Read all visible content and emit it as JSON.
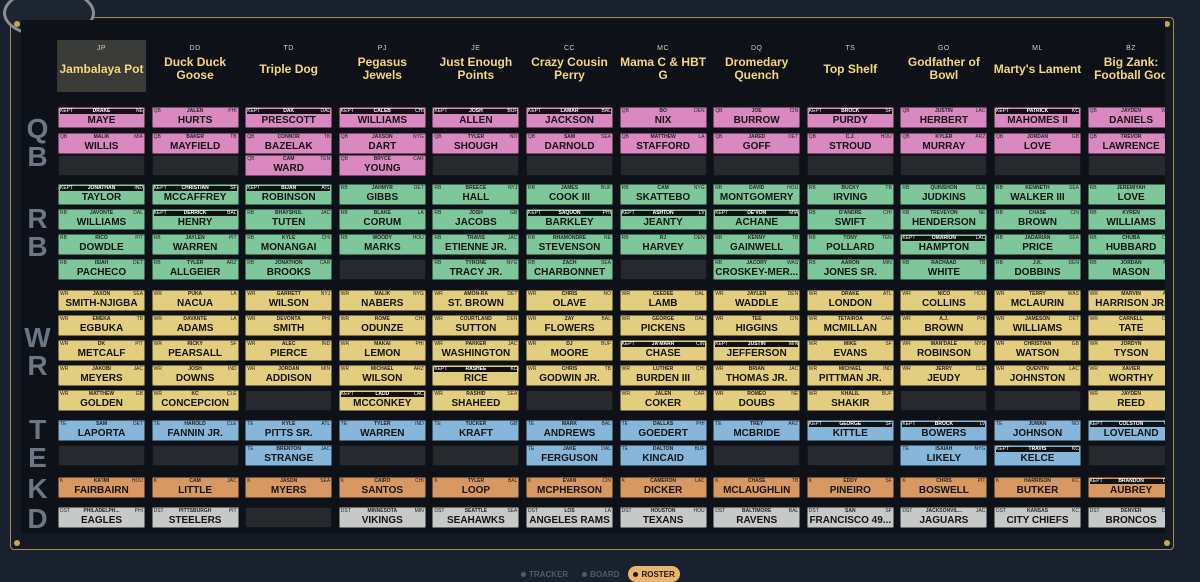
{
  "teams": [
    {
      "initials": "JP",
      "name": "Jambalaya Pot"
    },
    {
      "initials": "DD",
      "name": "Duck Duck Goose"
    },
    {
      "initials": "TD",
      "name": "Triple Dog"
    },
    {
      "initials": "PJ",
      "name": "Pegasus Jewels"
    },
    {
      "initials": "JE",
      "name": "Just Enough Points"
    },
    {
      "initials": "CC",
      "name": "Crazy Cousin Perry"
    },
    {
      "initials": "MC",
      "name": "Mama C & HBT G"
    },
    {
      "initials": "DQ",
      "name": "Dromedary Quench"
    },
    {
      "initials": "TS",
      "name": "Top Shelf"
    },
    {
      "initials": "GO",
      "name": "Godfather of Bowl"
    },
    {
      "initials": "ML",
      "name": "Marty's Lament"
    },
    {
      "initials": "BZ",
      "name": "Big Zank: Football God"
    }
  ],
  "positions": [
    {
      "label": "QB",
      "slots": 3
    },
    {
      "label": "RB",
      "slots": 4
    },
    {
      "label": "WR",
      "slots": 5
    },
    {
      "label": "TE",
      "slots": 2
    },
    {
      "label": "K",
      "slots": 1
    },
    {
      "label": "D",
      "slots": 1
    }
  ],
  "roster": [
    [
      [
        "QB",
        "DRAKE",
        "MAYE",
        "NE",
        1
      ],
      [
        "QB",
        "MALIK",
        "WILLIS",
        "MIA",
        0
      ],
      null,
      [
        "RB",
        "JONATHAN",
        "TAYLOR",
        "IND",
        1
      ],
      [
        "RB",
        "JAVONTE",
        "WILLIAMS",
        "DAL",
        0
      ],
      [
        "RB",
        "RICO",
        "DOWDLE",
        "PIT",
        0
      ],
      [
        "RB",
        "ISIAH",
        "PACHECO",
        "DET",
        0
      ],
      [
        "WR",
        "JAXON",
        "SMITH-NJIGBA",
        "SEA",
        0
      ],
      [
        "WR",
        "EMEKA",
        "EGBUKA",
        "TB",
        0
      ],
      [
        "WR",
        "DK",
        "METCALF",
        "PIT",
        0
      ],
      [
        "WR",
        "JAKOBI",
        "MEYERS",
        "JAC",
        0
      ],
      [
        "WR",
        "MATTHEW",
        "GOLDEN",
        "GB",
        0
      ],
      [
        "TE",
        "SAM",
        "LAPORTA",
        "DET",
        0
      ],
      null,
      [
        "K",
        "KA'IMI",
        "FAIRBAIRN",
        "HOU",
        0
      ],
      [
        "DST",
        "PHILADELPH...",
        "EAGLES",
        "PHI",
        0
      ]
    ],
    [
      [
        "QB",
        "JALEN",
        "HURTS",
        "PHI",
        0
      ],
      [
        "QB",
        "BAKER",
        "MAYFIELD",
        "TB",
        0
      ],
      null,
      [
        "RB",
        "CHRISTIAN",
        "MCCAFFREY",
        "SF",
        1
      ],
      [
        "RB",
        "DERRICK",
        "HENRY",
        "BAL",
        1
      ],
      [
        "RB",
        "JAYLEN",
        "WARREN",
        "PIT",
        0
      ],
      [
        "RB",
        "TYLER",
        "ALLGEIER",
        "ARZ",
        0
      ],
      [
        "WR",
        "PUKA",
        "NACUA",
        "LA",
        0
      ],
      [
        "WR",
        "DAVANTE",
        "ADAMS",
        "LA",
        0
      ],
      [
        "WR",
        "RICKY",
        "PEARSALL",
        "SF",
        0
      ],
      [
        "WR",
        "JOSH",
        "DOWNS",
        "IND",
        0
      ],
      [
        "WR",
        "KC",
        "CONCEPCION",
        "CLE",
        0
      ],
      [
        "TE",
        "HAROLD",
        "FANNIN JR.",
        "CLE",
        0
      ],
      null,
      [
        "K",
        "CAM",
        "LITTLE",
        "JAC",
        0
      ],
      [
        "DST",
        "PITTSBURGH",
        "STEELERS",
        "PIT",
        0
      ]
    ],
    [
      [
        "QB",
        "DAK",
        "PRESCOTT",
        "DAL",
        1
      ],
      [
        "QB",
        "CONNOR",
        "BAZELAK",
        "TB",
        0
      ],
      [
        "QB",
        "CAM",
        "WARD",
        "TEN",
        0
      ],
      [
        "RB",
        "BIJAN",
        "ROBINSON",
        "ATL",
        1
      ],
      [
        "RB",
        "BHAYSHUL",
        "TUTEN",
        "JAC",
        0
      ],
      [
        "RB",
        "KYLE",
        "MONANGAI",
        "CHI",
        0
      ],
      [
        "RB",
        "JONATHON",
        "BROOKS",
        "CAR",
        0
      ],
      [
        "WR",
        "GARRETT",
        "WILSON",
        "NYJ",
        0
      ],
      [
        "WR",
        "DEVONTA",
        "SMITH",
        "PHI",
        0
      ],
      [
        "WR",
        "ALEC",
        "PIERCE",
        "IND",
        0
      ],
      [
        "WR",
        "JORDAN",
        "ADDISON",
        "MIN",
        0
      ],
      null,
      [
        "TE",
        "KYLE",
        "PITTS SR.",
        "ATL",
        0
      ],
      [
        "TE",
        "BRENTON",
        "STRANGE",
        "JAC",
        0
      ],
      [
        "K",
        "JASON",
        "MYERS",
        "SEA",
        0
      ],
      null
    ],
    [
      [
        "QB",
        "CALEB",
        "WILLIAMS",
        "CHI",
        1
      ],
      [
        "QB",
        "JAXSON",
        "DART",
        "NYG",
        0
      ],
      [
        "QB",
        "BRYCE",
        "YOUNG",
        "CAR",
        0
      ],
      [
        "RB",
        "JAHMYR",
        "GIBBS",
        "DET",
        0
      ],
      [
        "RB",
        "BLAKE",
        "CORUM",
        "LA",
        0
      ],
      [
        "RB",
        "WOODY",
        "MARKS",
        "HOU",
        0
      ],
      null,
      [
        "WR",
        "MALIK",
        "NABERS",
        "NYG",
        0
      ],
      [
        "WR",
        "ROME",
        "ODUNZE",
        "CHI",
        0
      ],
      [
        "WR",
        "MAKAI",
        "LEMON",
        "PHI",
        0
      ],
      [
        "WR",
        "MICHAEL",
        "WILSON",
        "ARZ",
        0
      ],
      [
        "WR",
        "LADD",
        "MCCONKEY",
        "LAC",
        1
      ],
      [
        "TE",
        "TYLER",
        "WARREN",
        "IND",
        0
      ],
      null,
      [
        "K",
        "CAIRO",
        "SANTOS",
        "CHI",
        0
      ],
      [
        "DST",
        "MINNESOTA",
        "VIKINGS",
        "MIN",
        0
      ]
    ],
    [
      [
        "QB",
        "JOSH",
        "ALLEN",
        "BUF",
        1
      ],
      [
        "QB",
        "TYLER",
        "SHOUGH",
        "NO",
        0
      ],
      null,
      [
        "RB",
        "BREECE",
        "HALL",
        "NYJ",
        0
      ],
      [
        "RB",
        "JOSH",
        "JACOBS",
        "GB",
        0
      ],
      [
        "RB",
        "TRAVIS",
        "ETIENNE JR.",
        "JAC",
        0
      ],
      [
        "RB",
        "TYRONE",
        "TRACY JR.",
        "NYG",
        0
      ],
      [
        "WR",
        "AMON-RA",
        "ST. BROWN",
        "DET",
        0
      ],
      [
        "WR",
        "COURTLAND",
        "SUTTON",
        "DEN",
        0
      ],
      [
        "WR",
        "PARKER",
        "WASHINGTON",
        "JAC",
        0
      ],
      [
        "WR",
        "RASHEE",
        "RICE",
        "KC",
        1
      ],
      [
        "WR",
        "RASHID",
        "SHAHEED",
        "SEA",
        0
      ],
      [
        "TE",
        "TUCKER",
        "KRAFT",
        "GB",
        0
      ],
      null,
      [
        "K",
        "TYLER",
        "LOOP",
        "BAL",
        0
      ],
      [
        "DST",
        "SEATTLE",
        "SEAHAWKS",
        "SEA",
        0
      ]
    ],
    [
      [
        "QB",
        "LAMAR",
        "JACKSON",
        "BAL",
        1
      ],
      [
        "QB",
        "SAM",
        "DARNOLD",
        "SEA",
        0
      ],
      null,
      [
        "RB",
        "JAMES",
        "COOK III",
        "BUF",
        0
      ],
      [
        "RB",
        "SAQUON",
        "BARKLEY",
        "PHI",
        1
      ],
      [
        "RB",
        "RHAMONDRE",
        "STEVENSON",
        "NE",
        0
      ],
      [
        "RB",
        "ZACH",
        "CHARBONNET",
        "SEA",
        0
      ],
      [
        "WR",
        "CHRIS",
        "OLAVE",
        "NO",
        0
      ],
      [
        "WR",
        "ZAY",
        "FLOWERS",
        "BAL",
        0
      ],
      [
        "WR",
        "DJ",
        "MOORE",
        "BUF",
        0
      ],
      [
        "WR",
        "CHRIS",
        "GODWIN JR.",
        "TB",
        0
      ],
      null,
      [
        "TE",
        "MARK",
        "ANDREWS",
        "BAL",
        0
      ],
      [
        "TE",
        "JAKE",
        "FERGUSON",
        "DAL",
        0
      ],
      [
        "K",
        "EVAN",
        "MCPHERSON",
        "CIN",
        0
      ],
      [
        "DST",
        "LOS",
        "ANGELES RAMS",
        "LA",
        0
      ]
    ],
    [
      [
        "QB",
        "BO",
        "NIX",
        "DEN",
        0
      ],
      [
        "QB",
        "MATTHEW",
        "STAFFORD",
        "LA",
        0
      ],
      null,
      [
        "RB",
        "CAM",
        "SKATTEBO",
        "NYG",
        0
      ],
      [
        "RB",
        "ASHTON",
        "JEANTY",
        "LV",
        1
      ],
      [
        "RB",
        "RJ",
        "HARVEY",
        "DEN",
        0
      ],
      null,
      [
        "WR",
        "CEEDEE",
        "LAMB",
        "DAL",
        0
      ],
      [
        "WR",
        "GEORGE",
        "PICKENS",
        "DAL",
        0
      ],
      [
        "WR",
        "JA'MARR",
        "CHASE",
        "CIN",
        1
      ],
      [
        "WR",
        "LUTHER",
        "BURDEN III",
        "CHI",
        0
      ],
      [
        "WR",
        "JALEN",
        "COKER",
        "CAR",
        0
      ],
      [
        "TE",
        "DALLAS",
        "GOEDERT",
        "PHI",
        0
      ],
      [
        "TE",
        "DALTON",
        "KINCAID",
        "BUF",
        0
      ],
      [
        "K",
        "CAMERON",
        "DICKER",
        "LAC",
        0
      ],
      [
        "DST",
        "HOUSTON",
        "TEXANS",
        "HOU",
        0
      ]
    ],
    [
      [
        "QB",
        "JOE",
        "BURROW",
        "CIN",
        0
      ],
      [
        "QB",
        "JARED",
        "GOFF",
        "DET",
        0
      ],
      null,
      [
        "RB",
        "DAVID",
        "MONTGOMERY",
        "HOU",
        0
      ],
      [
        "RB",
        "DE'VON",
        "ACHANE",
        "MIA",
        1
      ],
      [
        "RB",
        "KENNY",
        "GAINWELL",
        "TB",
        0
      ],
      [
        "RB",
        "JACORY",
        "CROSKEY-MER...",
        "WAS",
        0
      ],
      [
        "WR",
        "JAYLEN",
        "WADDLE",
        "DEN",
        0
      ],
      [
        "WR",
        "TEE",
        "HIGGINS",
        "CIN",
        0
      ],
      [
        "WR",
        "JUSTIN",
        "JEFFERSON",
        "MIN",
        1
      ],
      [
        "WR",
        "BRIAN",
        "THOMAS JR.",
        "JAC",
        0
      ],
      [
        "WR",
        "ROMEO",
        "DOUBS",
        "NE",
        0
      ],
      [
        "TE",
        "TREY",
        "MCBRIDE",
        "ARZ",
        0
      ],
      null,
      [
        "K",
        "CHASE",
        "MCLAUGHLIN",
        "TB",
        0
      ],
      [
        "DST",
        "BALTIMORE",
        "RAVENS",
        "BAL",
        0
      ]
    ],
    [
      [
        "QB",
        "BROCK",
        "PURDY",
        "SF",
        1
      ],
      [
        "QB",
        "C.J.",
        "STROUD",
        "HOU",
        0
      ],
      null,
      [
        "RB",
        "BUCKY",
        "IRVING",
        "TB",
        0
      ],
      [
        "RB",
        "D'ANDRE",
        "SWIFT",
        "CHI",
        0
      ],
      [
        "RB",
        "TONY",
        "POLLARD",
        "TEN",
        0
      ],
      [
        "RB",
        "AARON",
        "JONES SR.",
        "MIN",
        0
      ],
      [
        "WR",
        "DRAKE",
        "LONDON",
        "ATL",
        0
      ],
      [
        "WR",
        "TETAIROA",
        "MCMILLAN",
        "CAR",
        0
      ],
      [
        "WR",
        "MIKE",
        "EVANS",
        "SF",
        0
      ],
      [
        "WR",
        "MICHAEL",
        "PITTMAN JR.",
        "IND",
        0
      ],
      [
        "WR",
        "KHALIL",
        "SHAKIR",
        "BUF",
        0
      ],
      [
        "TE",
        "GEORGE",
        "KITTLE",
        "SF",
        1
      ],
      null,
      [
        "K",
        "EDDY",
        "PINEIRO",
        "SF",
        0
      ],
      [
        "DST",
        "SAN",
        "FRANCISCO 49...",
        "SF",
        0
      ]
    ],
    [
      [
        "QB",
        "JUSTIN",
        "HERBERT",
        "LAC",
        0
      ],
      [
        "QB",
        "KYLER",
        "MURRAY",
        "ARZ",
        0
      ],
      null,
      [
        "RB",
        "QUINSHON",
        "JUDKINS",
        "CLE",
        0
      ],
      [
        "RB",
        "TREVEYON",
        "HENDERSON",
        "NE",
        0
      ],
      [
        "RB",
        "OMARION",
        "HAMPTON",
        "LAC",
        1
      ],
      [
        "RB",
        "RACHAAD",
        "WHITE",
        "TB",
        0
      ],
      [
        "WR",
        "NICO",
        "COLLINS",
        "HOU",
        0
      ],
      [
        "WR",
        "A.J.",
        "BROWN",
        "PHI",
        0
      ],
      [
        "WR",
        "WAN'DALE",
        "ROBINSON",
        "NYG",
        0
      ],
      [
        "WR",
        "JERRY",
        "JEUDY",
        "CLE",
        0
      ],
      null,
      [
        "TE",
        "BROCK",
        "BOWERS",
        "LV",
        1
      ],
      [
        "TE",
        "ISAIAH",
        "LIKELY",
        "NYG",
        0
      ],
      [
        "K",
        "CHRIS",
        "BOSWELL",
        "PIT",
        0
      ],
      [
        "DST",
        "JACKSONVIL...",
        "JAGUARS",
        "JAC",
        0
      ]
    ],
    [
      [
        "QB",
        "PATRICK",
        "MAHOMES II",
        "KC",
        1
      ],
      [
        "QB",
        "JORDAN",
        "LOVE",
        "GB",
        0
      ],
      null,
      [
        "RB",
        "KENNETH",
        "WALKER III",
        "SEA",
        0
      ],
      [
        "RB",
        "CHASE",
        "BROWN",
        "CIN",
        0
      ],
      [
        "RB",
        "JADARIAN",
        "PRICE",
        "SEA",
        0
      ],
      [
        "RB",
        "J.K.",
        "DOBBINS",
        "DEN",
        0
      ],
      [
        "WR",
        "TERRY",
        "MCLAURIN",
        "WAS",
        0
      ],
      [
        "WR",
        "JAMESON",
        "WILLIAMS",
        "DET",
        0
      ],
      [
        "WR",
        "CHRISTIAN",
        "WATSON",
        "GB",
        0
      ],
      [
        "WR",
        "QUENTIN",
        "JOHNSTON",
        "LAC",
        0
      ],
      null,
      [
        "TE",
        "JUWAN",
        "JOHNSON",
        "NO",
        0
      ],
      [
        "TE",
        "TRAVIS",
        "KELCE",
        "KC",
        1
      ],
      [
        "K",
        "HARRISON",
        "BUTKER",
        "KC",
        0
      ],
      [
        "DST",
        "KANSAS",
        "CITY CHIEFS",
        "KC",
        0
      ]
    ],
    [
      [
        "QB",
        "JAYDEN",
        "DANIELS",
        "WAS",
        0
      ],
      [
        "QB",
        "TREVOR",
        "LAWRENCE",
        "JAC",
        0
      ],
      null,
      [
        "RB",
        "JEREMIYAH",
        "LOVE",
        "ND",
        0
      ],
      [
        "RB",
        "KYREN",
        "WILLIAMS",
        "LA",
        0
      ],
      [
        "RB",
        "CHUBA",
        "HUBBARD",
        "CAR",
        0
      ],
      [
        "RB",
        "JORDAN",
        "MASON",
        "MIN",
        0
      ],
      [
        "WR",
        "MARVIN",
        "HARRISON JR.",
        "ARZ",
        0
      ],
      [
        "WR",
        "CARNELL",
        "TATE",
        "OSU",
        0
      ],
      [
        "WR",
        "JORDYN",
        "TYSON",
        "NO",
        0
      ],
      [
        "WR",
        "XAVIER",
        "WORTHY",
        "KC",
        0
      ],
      [
        "WR",
        "JAYDEN",
        "REED",
        "GB",
        0
      ],
      [
        "TE",
        "COLSTON",
        "LOVELAND",
        "CHI",
        1
      ],
      null,
      [
        "K",
        "BRANDON",
        "AUBREY",
        "DAL",
        1
      ],
      [
        "DST",
        "DENVER",
        "BRONCOS",
        "DEN",
        0
      ]
    ]
  ],
  "kept_label": "KEPT",
  "nav": {
    "tracker": "TRACKER",
    "board": "BOARD",
    "roster": "ROSTER"
  },
  "colors": {
    "QB": "#d989bf",
    "RB": "#7ec79b",
    "WR": "#e3cd7e",
    "TE": "#86b6d9",
    "K": "#d89862",
    "DST": "#c7c8c8",
    "accent": "#c7a65c"
  }
}
